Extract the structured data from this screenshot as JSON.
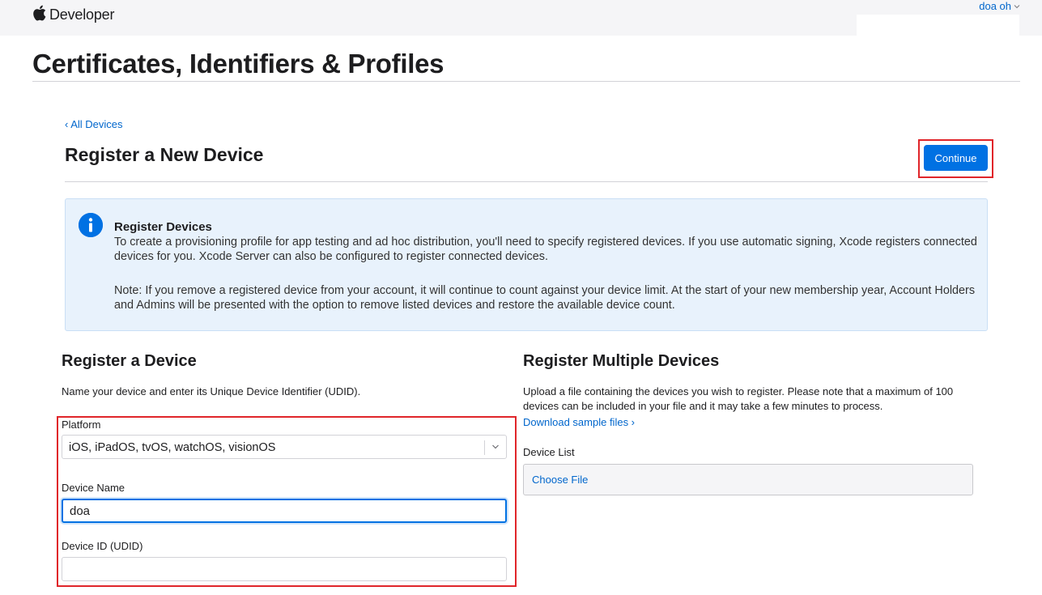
{
  "header": {
    "brand": "Developer",
    "user": "doa oh"
  },
  "page": {
    "title": "Certificates, Identifiers & Profiles"
  },
  "nav": {
    "back_link": "‹ All Devices"
  },
  "section": {
    "title": "Register a New Device",
    "continue_label": "Continue"
  },
  "info": {
    "heading": "Register Devices",
    "text": "To create a provisioning profile for app testing and ad hoc distribution, you'll need to specify registered devices. If you use automatic signing, Xcode registers connected devices for you. Xcode Server can also be configured to register connected devices.",
    "note": "Note: If you remove a registered device from your account, it will continue to count against your device limit. At the start of your new membership year, Account Holders and Admins will be presented with the option to remove listed devices and restore the available device count."
  },
  "single": {
    "title": "Register a Device",
    "description": "Name your device and enter its Unique Device Identifier (UDID).",
    "platform_label": "Platform",
    "platform_value": "iOS, iPadOS, tvOS, watchOS, visionOS",
    "name_label": "Device Name",
    "name_value": "doa",
    "udid_label": "Device ID (UDID)",
    "udid_value": ""
  },
  "multiple": {
    "title": "Register Multiple Devices",
    "description": "Upload a file containing the devices you wish to register. Please note that a maximum of 100 devices can be included in your file and it may take a few minutes to process.",
    "download_link": "Download sample files ›",
    "list_label": "Device List",
    "file_button": "Choose File"
  },
  "colors": {
    "accent": "#0071e3",
    "link": "#0066cc",
    "highlight": "#e0252a",
    "info_bg": "#e8f2fc"
  },
  "icons": [
    "apple-logo-icon",
    "chevron-down-icon",
    "info-icon",
    "select-chevron-icon"
  ]
}
